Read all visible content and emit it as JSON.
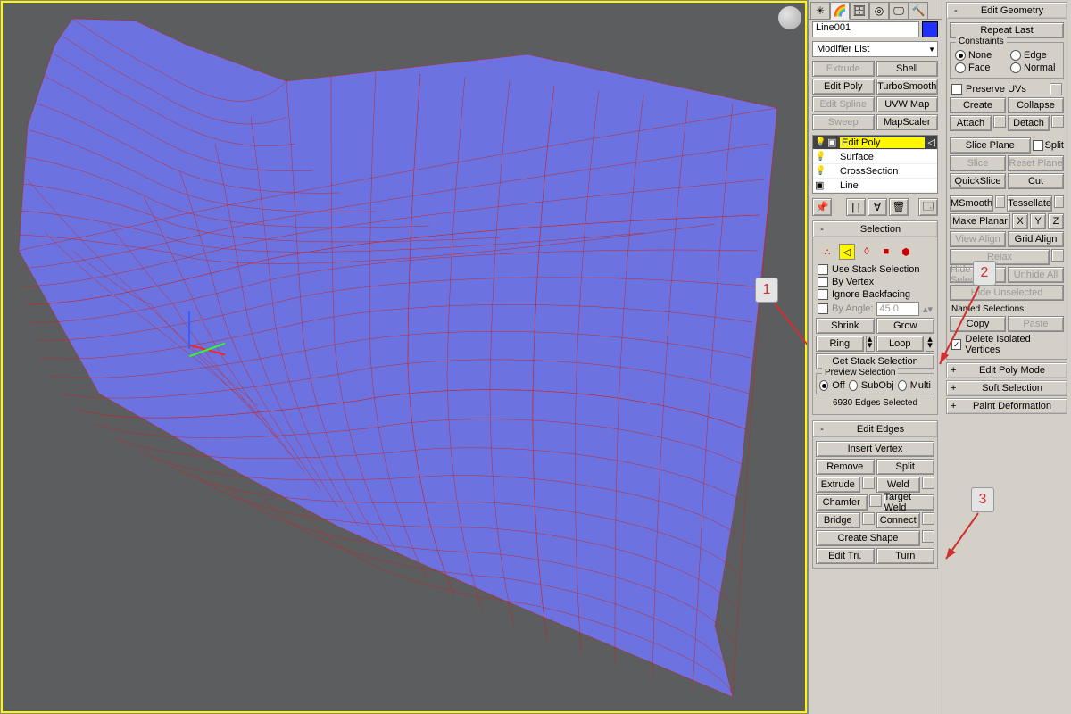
{
  "object_name": "Line001",
  "modifier_list_label": "Modifier List",
  "mod_buttons": {
    "extrude": "Extrude",
    "shell": "Shell",
    "editpoly": "Edit Poly",
    "turbosmooth": "TurboSmooth",
    "editspline": "Edit Spline",
    "uvwmap": "UVW Map",
    "sweep": "Sweep",
    "mapscaler": "MapScaler"
  },
  "stack": {
    "editpoly": "Edit Poly",
    "surface": "Surface",
    "crosssection": "CrossSection",
    "line": "Line"
  },
  "selection": {
    "title": "Selection",
    "use_stack": "Use Stack Selection",
    "by_vertex": "By Vertex",
    "ignore_backfacing": "Ignore Backfacing",
    "by_angle": "By Angle:",
    "angle_value": "45,0",
    "shrink": "Shrink",
    "grow": "Grow",
    "ring": "Ring",
    "loop": "Loop",
    "get_stack": "Get Stack Selection",
    "preview_label": "Preview Selection",
    "off": "Off",
    "subobj": "SubObj",
    "multi": "Multi",
    "status": "6930 Edges Selected"
  },
  "edit_edges": {
    "title": "Edit Edges",
    "insert_vertex": "Insert Vertex",
    "remove": "Remove",
    "split": "Split",
    "extrude": "Extrude",
    "weld": "Weld",
    "chamfer": "Chamfer",
    "target_weld": "Target Weld",
    "bridge": "Bridge",
    "connect": "Connect",
    "create_shape": "Create Shape",
    "edit_tri": "Edit Tri.",
    "turn": "Turn"
  },
  "edit_geo": {
    "title": "Edit Geometry",
    "repeat_last": "Repeat Last",
    "constraints": "Constraints",
    "none": "None",
    "edge": "Edge",
    "face": "Face",
    "normal": "Normal",
    "preserve_uvs": "Preserve UVs",
    "create": "Create",
    "collapse": "Collapse",
    "attach": "Attach",
    "detach": "Detach",
    "slice_plane": "Slice Plane",
    "split": "Split",
    "slice": "Slice",
    "reset_plane": "Reset Plane",
    "quickslice": "QuickSlice",
    "cut": "Cut",
    "msmooth": "MSmooth",
    "tessellate": "Tessellate",
    "make_planar": "Make Planar",
    "x": "X",
    "y": "Y",
    "z": "Z",
    "view_align": "View Align",
    "grid_align": "Grid Align",
    "relax": "Relax",
    "hide_selected": "Hide Selected",
    "unhide_all": "Unhide All",
    "hide_unselected": "Hide Unselected",
    "named_selections": "Named Selections:",
    "copy": "Copy",
    "paste": "Paste",
    "delete_isolated": "Delete Isolated Vertices"
  },
  "extra_rollouts": {
    "edit_poly_mode": "Edit Poly Mode",
    "soft_selection": "Soft Selection",
    "paint_deformation": "Paint Deformation"
  },
  "annotations": {
    "a1": "1",
    "a2": "2",
    "a3": "3"
  }
}
